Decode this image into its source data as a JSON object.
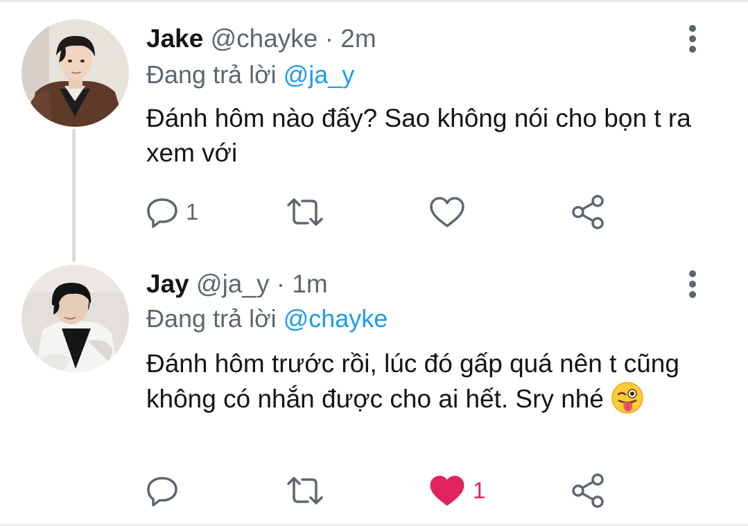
{
  "thread": [
    {
      "name": "Jake",
      "handle": "@chayke",
      "separator": "·",
      "time": "2m",
      "reply_prefix": "Đang trả lời",
      "reply_to": "@ja_y",
      "text": "Đánh hôm nào đấy? Sao không nói cho bọn t ra xem với",
      "reply_count": "1",
      "retweet_count": "",
      "like_count": "",
      "liked": false
    },
    {
      "name": "Jay",
      "handle": "@ja_y",
      "separator": "·",
      "time": "1m",
      "reply_prefix": "Đang trả lời",
      "reply_to": "@chayke",
      "text": "Đánh hôm trước rồi, lúc đó gấp quá nên t cũng không có nhắn được cho ai hết. Sry nhé",
      "emoji": "winking-face-with-tongue",
      "reply_count": "",
      "retweet_count": "",
      "like_count": "1",
      "liked": true
    }
  ],
  "icons": {
    "more": "more-vertical-icon",
    "reply": "reply-icon",
    "retweet": "retweet-icon",
    "like": "heart-icon",
    "share": "share-icon"
  },
  "colors": {
    "accent": "#1d9bf0",
    "like": "#e0245e",
    "muted": "#5c6670",
    "text": "#141414",
    "thread_line": "#d9dde1"
  }
}
